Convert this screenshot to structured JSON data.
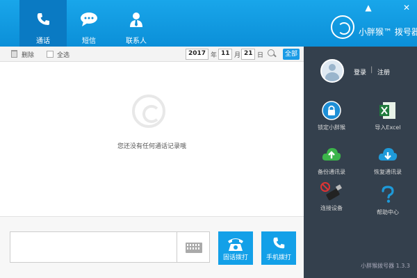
{
  "header": {
    "tabs": [
      {
        "label": "通话",
        "icon": "phone-icon",
        "active": true
      },
      {
        "label": "短信",
        "icon": "message-icon",
        "active": false
      },
      {
        "label": "联系人",
        "icon": "contact-icon",
        "active": false
      }
    ],
    "brand_name": "小胖猴™ 拨号器",
    "window_controls": {
      "collapse": "▲",
      "close": "✕"
    }
  },
  "toolbar": {
    "delete_label": "删除",
    "select_all_label": "全选",
    "year": "2017",
    "year_unit": "年",
    "month": "11",
    "month_unit": "月",
    "day": "21",
    "day_unit": "日",
    "all_label": "全部"
  },
  "main": {
    "empty_text": "您还没有任何通话记录哦"
  },
  "dial": {
    "number_value": "",
    "landline_label": "固话拨打",
    "mobile_label": "手机拨打"
  },
  "sidebar": {
    "login_label": "登录",
    "register_label": "注册",
    "separator": "|",
    "tools": [
      {
        "label": "锁定小胖猴",
        "icon": "lock-icon"
      },
      {
        "label": "导入Excel",
        "icon": "excel-icon"
      },
      {
        "label": "备份通讯录",
        "icon": "cloud-upload-icon"
      },
      {
        "label": "恢复通讯录",
        "icon": "cloud-download-icon"
      },
      {
        "label": "连接设备",
        "icon": "usb-device-icon"
      },
      {
        "label": "帮助中心",
        "icon": "help-icon"
      }
    ],
    "version": "小胖猴拨号器 1.3.3"
  },
  "colors": {
    "accent": "#13a0e8",
    "header": "#0b8fd8",
    "sidebar": "#34404d"
  }
}
